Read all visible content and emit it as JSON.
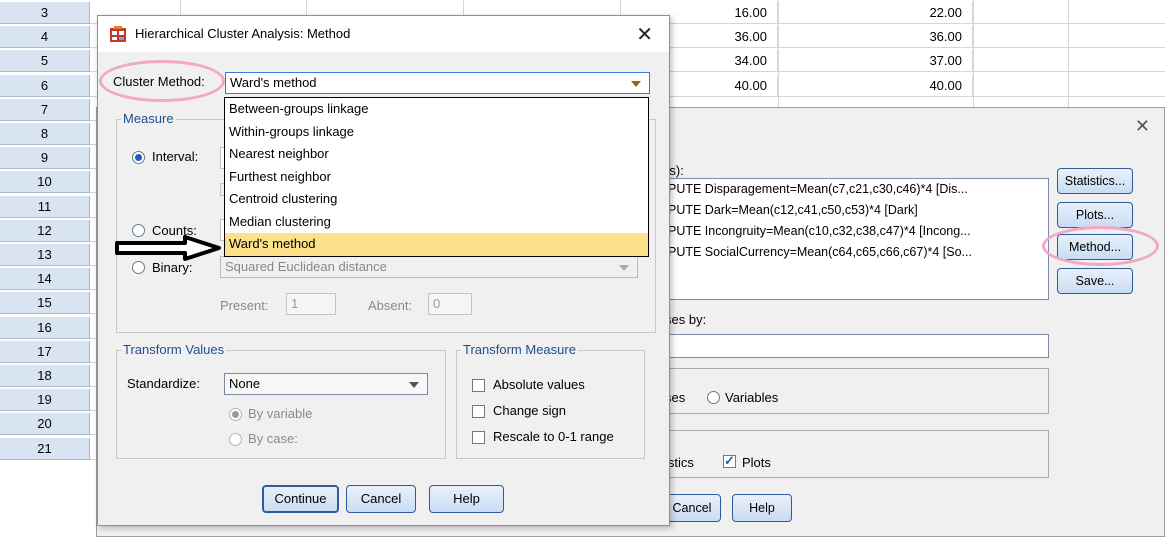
{
  "spreadsheet": {
    "rows": [
      {
        "num": "3",
        "c1": "16.00",
        "c2": "22.00"
      },
      {
        "num": "4",
        "c1": "36.00",
        "c2": "36.00"
      },
      {
        "num": "5",
        "c1": "34.00",
        "c2": "37.00"
      },
      {
        "num": "6",
        "c1": "40.00",
        "c2": "40.00"
      },
      {
        "num": "7"
      },
      {
        "num": "8"
      },
      {
        "num": "9"
      },
      {
        "num": "10"
      },
      {
        "num": "11"
      },
      {
        "num": "12"
      },
      {
        "num": "13"
      },
      {
        "num": "14"
      },
      {
        "num": "15"
      },
      {
        "num": "16"
      },
      {
        "num": "17"
      },
      {
        "num": "18"
      },
      {
        "num": "19"
      },
      {
        "num": "20"
      },
      {
        "num": "21"
      }
    ]
  },
  "parent_dialog": {
    "variables_label": "(s):",
    "variables": [
      "PUTE Disparagement=Mean(c7,c21,c30,c46)*4 [Dis...",
      "PUTE Dark=Mean(c12,c41,c50,c53)*4 [Dark]",
      "PUTE Incongruity=Mean(c10,c32,c38,c47)*4 [Incong...",
      "PUTE SocialCurrency=Mean(c64,c65,c66,c67)*4 [So..."
    ],
    "label_cases_label": "ses by:",
    "cluster_cases_label": "ses",
    "cluster_variables_label": "Variables",
    "display_statistics_label": "istics",
    "display_plots_label": "Plots",
    "buttons": {
      "statistics": "Statistics...",
      "plots": "Plots...",
      "method": "Method...",
      "save": "Save..."
    },
    "cancel_label": "Cancel",
    "help_label": "Help"
  },
  "dialog": {
    "title": "Hierarchical Cluster Analysis: Method",
    "cluster_method_label": "Cluster Method:",
    "cluster_method_value": "Ward's method",
    "cluster_method_options": [
      "Between-groups linkage",
      "Within-groups linkage",
      "Nearest neighbor",
      "Furthest neighbor",
      "Centroid clustering",
      "Median clustering",
      "Ward's method"
    ],
    "measure": {
      "legend": "Measure",
      "interval_label": "Interval:",
      "counts_label": "Counts:",
      "binary_label": "Binary:",
      "binary_value": "Squared Euclidean distance",
      "present_label": "Present:",
      "present_value": "1",
      "absent_label": "Absent:",
      "absent_value": "0"
    },
    "transform_values": {
      "legend": "Transform Values",
      "standardize_label": "Standardize:",
      "standardize_value": "None",
      "by_variable_label": "By variable",
      "by_case_label": "By case:"
    },
    "transform_measure": {
      "legend": "Transform Measure",
      "absolute_label": "Absolute values",
      "change_sign_label": "Change sign",
      "rescale_label": "Rescale to 0-1 range"
    },
    "buttons": {
      "continue": "Continue",
      "cancel": "Cancel",
      "help": "Help"
    }
  },
  "colors": {
    "accent": "#1f4e8c",
    "highlight": "#fde08a",
    "annotation": "#f2a7c3"
  }
}
